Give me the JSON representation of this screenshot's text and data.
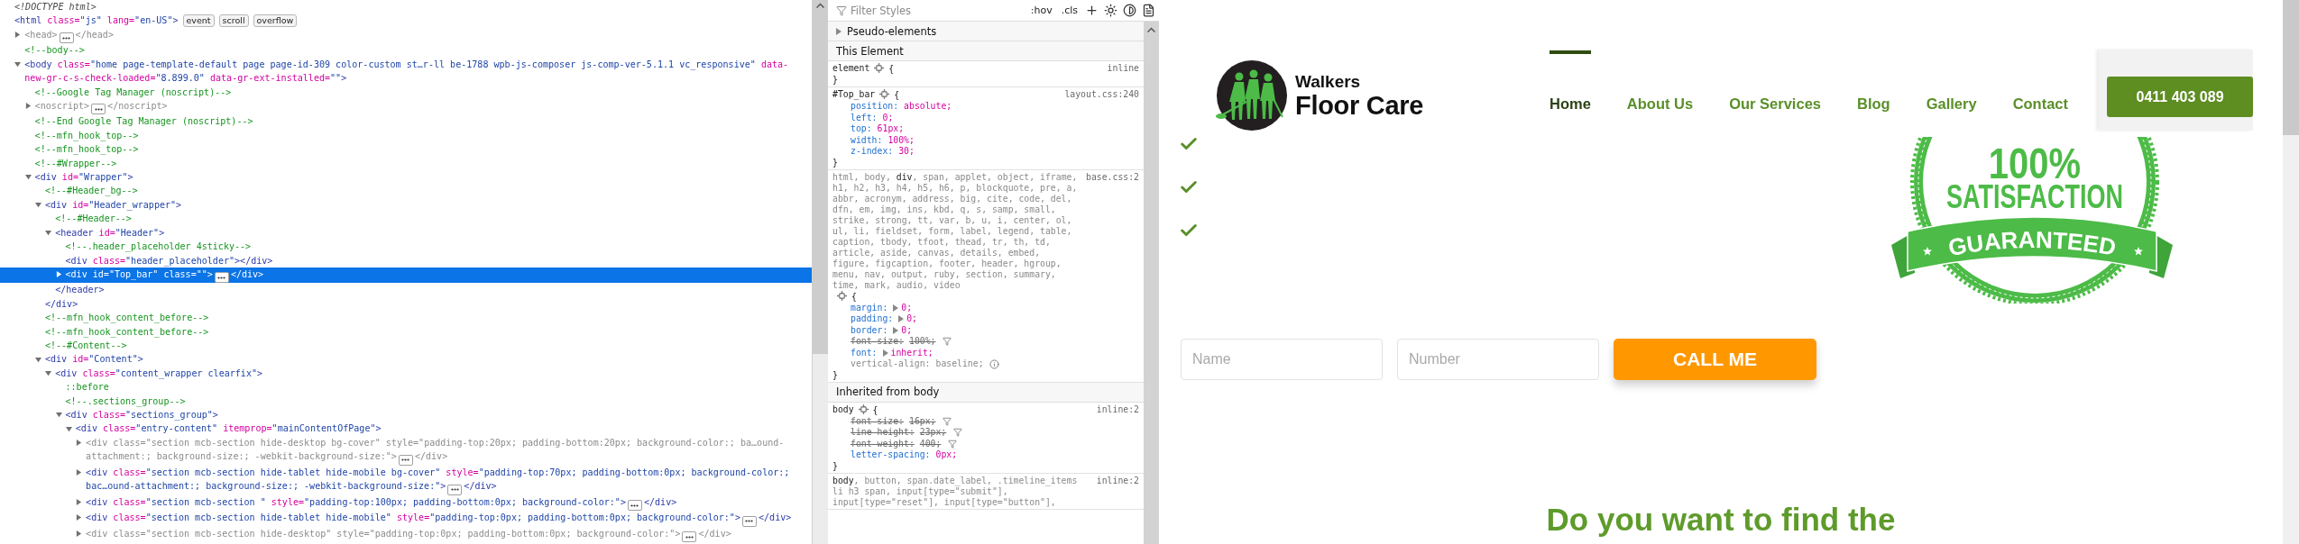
{
  "inspector": {
    "nodes": [
      {
        "parts": [
          {
            "kind": "doctype",
            "text": "<!DOCTYPE html>"
          }
        ],
        "selected": false,
        "dimmed": false
      },
      {
        "parts": [
          {
            "kind": "tag",
            "text": "<html"
          },
          {
            "kind": "attr",
            "text": " class="
          },
          {
            "kind": "value",
            "text": "\"js\""
          },
          {
            "kind": "attr",
            "text": " lang="
          },
          {
            "kind": "value",
            "text": "\"en-US\""
          },
          {
            "kind": "tag",
            "text": ">"
          },
          {
            "kind": "badge",
            "text": "event"
          },
          {
            "kind": "badge",
            "text": "scroll"
          },
          {
            "kind": "badge",
            "text": "overflow"
          }
        ],
        "selected": false,
        "dimmed": false,
        "children": [
          {
            "parts": [
              {
                "kind": "tag",
                "text": "<head>"
              },
              {
                "kind": "more"
              },
              {
                "kind": "tag",
                "text": "</head>"
              }
            ],
            "expanded": false,
            "selected": false,
            "dimmed": true
          },
          {
            "parts": [
              {
                "kind": "comment",
                "text": "<!--body-->"
              }
            ],
            "selected": false,
            "dimmed": false
          },
          {
            "parts": [
              {
                "kind": "tag",
                "text": "<body"
              },
              {
                "kind": "attr",
                "text": " class="
              },
              {
                "kind": "value",
                "text": "\"home page-template-default page page-id-309 color-custom st…r-ll be-1788 wpb-js-composer js-comp-ver-5.1.1 vc_responsive\""
              },
              {
                "kind": "attr",
                "text": " data-new-gr-c-s-check-loaded="
              },
              {
                "kind": "value",
                "text": "\"8.899.0\""
              },
              {
                "kind": "attr",
                "text": " data-gr-ext-installed="
              },
              {
                "kind": "value",
                "text": "\"\""
              },
              {
                "kind": "tag",
                "text": ">"
              }
            ],
            "expanded": true,
            "selected": false,
            "dimmed": false,
            "children": [
              {
                "parts": [
                  {
                    "kind": "comment",
                    "text": "<!--Google Tag Manager (noscript)-->"
                  }
                ],
                "selected": false,
                "dimmed": false
              },
              {
                "parts": [
                  {
                    "kind": "tag",
                    "text": "<noscript>"
                  },
                  {
                    "kind": "more"
                  },
                  {
                    "kind": "tag",
                    "text": "</noscript>"
                  }
                ],
                "expanded": false,
                "selected": false,
                "dimmed": true
              },
              {
                "parts": [
                  {
                    "kind": "comment",
                    "text": "<!--End Google Tag Manager (noscript)-->"
                  }
                ],
                "selected": false,
                "dimmed": false
              },
              {
                "parts": [
                  {
                    "kind": "comment",
                    "text": "<!--mfn_hook_top-->"
                  }
                ],
                "selected": false,
                "dimmed": false
              },
              {
                "parts": [
                  {
                    "kind": "comment",
                    "text": "<!--mfn_hook_top-->"
                  }
                ],
                "selected": false,
                "dimmed": false
              },
              {
                "parts": [
                  {
                    "kind": "comment",
                    "text": "<!--#Wrapper-->"
                  }
                ],
                "selected": false,
                "dimmed": false
              },
              {
                "parts": [
                  {
                    "kind": "tag",
                    "text": "<div"
                  },
                  {
                    "kind": "attr",
                    "text": " id="
                  },
                  {
                    "kind": "value",
                    "text": "\"Wrapper\""
                  },
                  {
                    "kind": "tag",
                    "text": ">"
                  }
                ],
                "expanded": true,
                "selected": false,
                "dimmed": false,
                "children": [
                  {
                    "parts": [
                      {
                        "kind": "comment",
                        "text": "<!--#Header_bg-->"
                      }
                    ],
                    "selected": false,
                    "dimmed": false
                  },
                  {
                    "parts": [
                      {
                        "kind": "tag",
                        "text": "<div"
                      },
                      {
                        "kind": "attr",
                        "text": " id="
                      },
                      {
                        "kind": "value",
                        "text": "\"Header_wrapper\""
                      },
                      {
                        "kind": "tag",
                        "text": ">"
                      }
                    ],
                    "expanded": true,
                    "selected": false,
                    "dimmed": false,
                    "closing": [
                      {
                        "kind": "tag",
                        "text": "</div>"
                      }
                    ],
                    "children": [
                      {
                        "parts": [
                          {
                            "kind": "comment",
                            "text": "<!--#Header-->"
                          }
                        ],
                        "selected": false,
                        "dimmed": false
                      },
                      {
                        "parts": [
                          {
                            "kind": "tag",
                            "text": "<header"
                          },
                          {
                            "kind": "attr",
                            "text": " id="
                          },
                          {
                            "kind": "value",
                            "text": "\"Header\""
                          },
                          {
                            "kind": "tag",
                            "text": ">"
                          }
                        ],
                        "expanded": true,
                        "selected": false,
                        "dimmed": false,
                        "closing": [
                          {
                            "kind": "tag",
                            "text": "</header>"
                          }
                        ],
                        "children": [
                          {
                            "parts": [
                              {
                                "kind": "comment",
                                "text": "<!--.header_placeholder 4sticky-->"
                              }
                            ],
                            "selected": false,
                            "dimmed": false
                          },
                          {
                            "parts": [
                              {
                                "kind": "tag",
                                "text": "<div"
                              },
                              {
                                "kind": "attr",
                                "text": " class="
                              },
                              {
                                "kind": "value",
                                "text": "\"header_placeholder\""
                              },
                              {
                                "kind": "tag",
                                "text": "></div>"
                              }
                            ],
                            "selected": false,
                            "dimmed": false
                          },
                          {
                            "parts": [
                              {
                                "kind": "tag",
                                "text": "<div"
                              },
                              {
                                "kind": "attr",
                                "text": " id="
                              },
                              {
                                "kind": "value",
                                "text": "\"Top_bar\""
                              },
                              {
                                "kind": "attr",
                                "text": " class="
                              },
                              {
                                "kind": "value",
                                "text": "\"\""
                              },
                              {
                                "kind": "tag",
                                "text": ">"
                              },
                              {
                                "kind": "more"
                              },
                              {
                                "kind": "tag",
                                "text": "</div>"
                              }
                            ],
                            "expanded": false,
                            "selected": true,
                            "dimmed": false
                          }
                        ]
                      }
                    ]
                  },
                  {
                    "parts": [
                      {
                        "kind": "comment",
                        "text": "<!--mfn_hook_content_before-->"
                      }
                    ],
                    "selected": false,
                    "dimmed": false
                  },
                  {
                    "parts": [
                      {
                        "kind": "comment",
                        "text": "<!--mfn_hook_content_before-->"
                      }
                    ],
                    "selected": false,
                    "dimmed": false
                  },
                  {
                    "parts": [
                      {
                        "kind": "comment",
                        "text": "<!--#Content-->"
                      }
                    ],
                    "selected": false,
                    "dimmed": false
                  },
                  {
                    "parts": [
                      {
                        "kind": "tag",
                        "text": "<div"
                      },
                      {
                        "kind": "attr",
                        "text": " id="
                      },
                      {
                        "kind": "value",
                        "text": "\"Content\""
                      },
                      {
                        "kind": "tag",
                        "text": ">"
                      }
                    ],
                    "expanded": true,
                    "selected": false,
                    "dimmed": false,
                    "children": [
                      {
                        "parts": [
                          {
                            "kind": "tag",
                            "text": "<div"
                          },
                          {
                            "kind": "attr",
                            "text": " class="
                          },
                          {
                            "kind": "value",
                            "text": "\"content_wrapper clearfix\""
                          },
                          {
                            "kind": "tag",
                            "text": ">"
                          }
                        ],
                        "expanded": true,
                        "selected": false,
                        "dimmed": false,
                        "children": [
                          {
                            "parts": [
                              {
                                "kind": "pseudo",
                                "text": "::before"
                              }
                            ],
                            "selected": false,
                            "dimmed": false
                          },
                          {
                            "parts": [
                              {
                                "kind": "comment",
                                "text": "<!--.sections_group-->"
                              }
                            ],
                            "selected": false,
                            "dimmed": false
                          },
                          {
                            "parts": [
                              {
                                "kind": "tag",
                                "text": "<div"
                              },
                              {
                                "kind": "attr",
                                "text": " class="
                              },
                              {
                                "kind": "value",
                                "text": "\"sections_group\""
                              },
                              {
                                "kind": "tag",
                                "text": ">"
                              }
                            ],
                            "expanded": true,
                            "selected": false,
                            "dimmed": false,
                            "children": [
                              {
                                "parts": [
                                  {
                                    "kind": "tag",
                                    "text": "<div"
                                  },
                                  {
                                    "kind": "attr",
                                    "text": " class="
                                  },
                                  {
                                    "kind": "value",
                                    "text": "\"entry-content\""
                                  },
                                  {
                                    "kind": "attr",
                                    "text": " itemprop="
                                  },
                                  {
                                    "kind": "value",
                                    "text": "\"mainContentOfPage\""
                                  },
                                  {
                                    "kind": "tag",
                                    "text": ">"
                                  }
                                ],
                                "expanded": true,
                                "selected": false,
                                "dimmed": false,
                                "children": [
                                  {
                                    "parts": [
                                      {
                                        "kind": "tag",
                                        "text": "<div"
                                      },
                                      {
                                        "kind": "attr",
                                        "text": " class="
                                      },
                                      {
                                        "kind": "value",
                                        "text": "\"section mcb-section hide-desktop bg-cover\""
                                      },
                                      {
                                        "kind": "attr",
                                        "text": " style="
                                      },
                                      {
                                        "kind": "value",
                                        "text": "\"padding-top:20px; padding-bottom:20px; background-color:; ba…ound-attachment:; background-size:; -webkit-background-size:\""
                                      },
                                      {
                                        "kind": "tag",
                                        "text": ">"
                                      },
                                      {
                                        "kind": "more"
                                      },
                                      {
                                        "kind": "tag",
                                        "text": "</div>"
                                      }
                                    ],
                                    "expanded": false,
                                    "selected": false,
                                    "dimmed": true
                                  },
                                  {
                                    "parts": [
                                      {
                                        "kind": "tag",
                                        "text": "<div"
                                      },
                                      {
                                        "kind": "attr",
                                        "text": " class="
                                      },
                                      {
                                        "kind": "value",
                                        "text": "\"section mcb-section hide-tablet hide-mobile bg-cover\""
                                      },
                                      {
                                        "kind": "attr",
                                        "text": " style="
                                      },
                                      {
                                        "kind": "value",
                                        "text": "\"padding-top:70px; padding-bottom:0px; background-color:; bac…ound-attachment:; background-size:; -webkit-background-size:\""
                                      },
                                      {
                                        "kind": "tag",
                                        "text": ">"
                                      },
                                      {
                                        "kind": "more"
                                      },
                                      {
                                        "kind": "tag",
                                        "text": "</div>"
                                      }
                                    ],
                                    "expanded": false,
                                    "selected": false,
                                    "dimmed": false
                                  },
                                  {
                                    "parts": [
                                      {
                                        "kind": "tag",
                                        "text": "<div"
                                      },
                                      {
                                        "kind": "attr",
                                        "text": " class="
                                      },
                                      {
                                        "kind": "value",
                                        "text": "\"section mcb-section \""
                                      },
                                      {
                                        "kind": "attr",
                                        "text": " style="
                                      },
                                      {
                                        "kind": "value",
                                        "text": "\"padding-top:100px; padding-bottom:0px; background-color:\""
                                      },
                                      {
                                        "kind": "tag",
                                        "text": ">"
                                      },
                                      {
                                        "kind": "more"
                                      },
                                      {
                                        "kind": "tag",
                                        "text": "</div>"
                                      }
                                    ],
                                    "expanded": false,
                                    "selected": false,
                                    "dimmed": false
                                  },
                                  {
                                    "parts": [
                                      {
                                        "kind": "tag",
                                        "text": "<div"
                                      },
                                      {
                                        "kind": "attr",
                                        "text": " class="
                                      },
                                      {
                                        "kind": "value",
                                        "text": "\"section mcb-section hide-tablet hide-mobile\""
                                      },
                                      {
                                        "kind": "attr",
                                        "text": " style="
                                      },
                                      {
                                        "kind": "value",
                                        "text": "\"padding-top:0px; padding-bottom:0px; background-color:\""
                                      },
                                      {
                                        "kind": "tag",
                                        "text": ">"
                                      },
                                      {
                                        "kind": "more"
                                      },
                                      {
                                        "kind": "tag",
                                        "text": "</div>"
                                      }
                                    ],
                                    "expanded": false,
                                    "selected": false,
                                    "dimmed": false
                                  },
                                  {
                                    "parts": [
                                      {
                                        "kind": "tag",
                                        "text": "<div"
                                      },
                                      {
                                        "kind": "attr",
                                        "text": " class="
                                      },
                                      {
                                        "kind": "value",
                                        "text": "\"section mcb-section hide-desktop\""
                                      },
                                      {
                                        "kind": "attr",
                                        "text": " style="
                                      },
                                      {
                                        "kind": "value",
                                        "text": "\"padding-top:0px; padding-bottom:0px; background-color:\""
                                      },
                                      {
                                        "kind": "tag",
                                        "text": ">"
                                      },
                                      {
                                        "kind": "more"
                                      },
                                      {
                                        "kind": "tag",
                                        "text": "</div>"
                                      }
                                    ],
                                    "expanded": false,
                                    "selected": false,
                                    "dimmed": true
                                  }
                                ]
                              }
                            ]
                          }
                        ]
                      }
                    ]
                  }
                ]
              }
            ]
          }
        ]
      }
    ]
  },
  "styles": {
    "filter": {
      "placeholder": "Filter Styles"
    },
    "toggles": [
      {
        "label": ":hov"
      },
      {
        "label": ".cls"
      }
    ],
    "pseudo_elements": {
      "label": "Pseudo-elements",
      "expanded": false
    },
    "sections": [
      {
        "heading": "This Element",
        "rules": [
          {
            "selector": [
              {
                "text": "element",
                "matched": true
              }
            ],
            "open": "{",
            "source": "inline",
            "close": "}"
          },
          {
            "selector": [
              {
                "text": "#Top_bar",
                "matched": true
              }
            ],
            "open": "{",
            "source": "layout.css:240",
            "declarations": [
              {
                "property": "position:",
                "value": "absolute;",
                "overridden": false,
                "inactive": false,
                "expandable": false
              },
              {
                "property": "left:",
                "value": "0;",
                "overridden": false,
                "inactive": false,
                "expandable": false
              },
              {
                "property": "top:",
                "value": "61px;",
                "overridden": false,
                "inactive": false,
                "expandable": false
              },
              {
                "property": "width:",
                "value": "100%;",
                "overridden": false,
                "inactive": false,
                "expandable": false
              },
              {
                "property": "z-index:",
                "value": "30;",
                "overridden": false,
                "inactive": false,
                "expandable": false
              }
            ],
            "close": "}"
          },
          {
            "selector": [
              {
                "text": "html, body, ",
                "matched": false
              },
              {
                "text": "div",
                "matched": true
              },
              {
                "text": ", span, applet, object, iframe, h1, h2, h3, h4, h5, h6, p, blockquote, pre, a, abbr, acronym, address, big, cite, code, del, dfn, em, img, ins, kbd, q, s, samp, small, strike, strong, tt, var, b, u, i, center, ol, ul, li, fieldset, form, label, legend, table, caption, tbody, tfoot, thead, tr, th, td, article, aside, canvas, details, embed, figure, figcaption, footer, header, hgroup, menu, nav, output, ruby, section, summary, time, mark, audio, video",
                "matched": false
              }
            ],
            "open": "{",
            "source": "base.css:2",
            "declarations": [
              {
                "property": "margin:",
                "value": "0;",
                "overridden": false,
                "inactive": false,
                "expandable": true
              },
              {
                "property": "padding:",
                "value": "0;",
                "overridden": false,
                "inactive": false,
                "expandable": true
              },
              {
                "property": "border:",
                "value": "0;",
                "overridden": false,
                "inactive": false,
                "expandable": true
              },
              {
                "property": "font-size:",
                "value": "100%;",
                "overridden": true,
                "inactive": false,
                "expandable": false
              },
              {
                "property": "font:",
                "value": "inherit;",
                "overridden": false,
                "inactive": false,
                "expandable": true
              },
              {
                "property": "vertical-align:",
                "value": "baseline;",
                "overridden": false,
                "inactive": true,
                "expandable": false
              }
            ],
            "close": "}"
          }
        ]
      },
      {
        "heading": "Inherited from body",
        "rules": [
          {
            "selector": [
              {
                "text": "body",
                "matched": true
              }
            ],
            "open": "{",
            "source": "inline:2",
            "declarations": [
              {
                "property": "font-size:",
                "value": "16px;",
                "overridden": true,
                "inactive": false,
                "expandable": false
              },
              {
                "property": "line-height:",
                "value": "23px;",
                "overridden": true,
                "inactive": false,
                "expandable": false
              },
              {
                "property": "font-weight:",
                "value": "400;",
                "overridden": true,
                "inactive": false,
                "expandable": false
              },
              {
                "property": "letter-spacing:",
                "value": "0px;",
                "overridden": false,
                "inactive": false,
                "expandable": false
              }
            ],
            "close": "}"
          },
          {
            "selector": [
              {
                "text": "body",
                "matched": true
              },
              {
                "text": ", button, span.date_label, .timeline_items li h3 span, input[type=\"submit\"], input[type=\"reset\"], input[type=\"button\"],",
                "matched": false
              }
            ],
            "source": "inline:2"
          }
        ]
      }
    ]
  },
  "page": {
    "logo": {
      "name": "Walkers",
      "tagline": "Floor Care"
    },
    "nav": [
      {
        "label": "Home",
        "selected": true
      },
      {
        "label": "About Us",
        "selected": false
      },
      {
        "label": "Our Services",
        "selected": false
      },
      {
        "label": "Blog",
        "selected": false
      },
      {
        "label": "Gallery",
        "selected": false
      },
      {
        "label": "Contact",
        "selected": false
      }
    ],
    "phone_button": "0411 403 089",
    "seal": {
      "figure": "100%",
      "line1": "SATISFACTION",
      "line2": "GUARANTEED"
    },
    "form": {
      "fields": [
        {
          "placeholder": "Name"
        },
        {
          "placeholder": "Number"
        }
      ],
      "submit": "CALL ME"
    },
    "heading": "Do you want to find the"
  }
}
